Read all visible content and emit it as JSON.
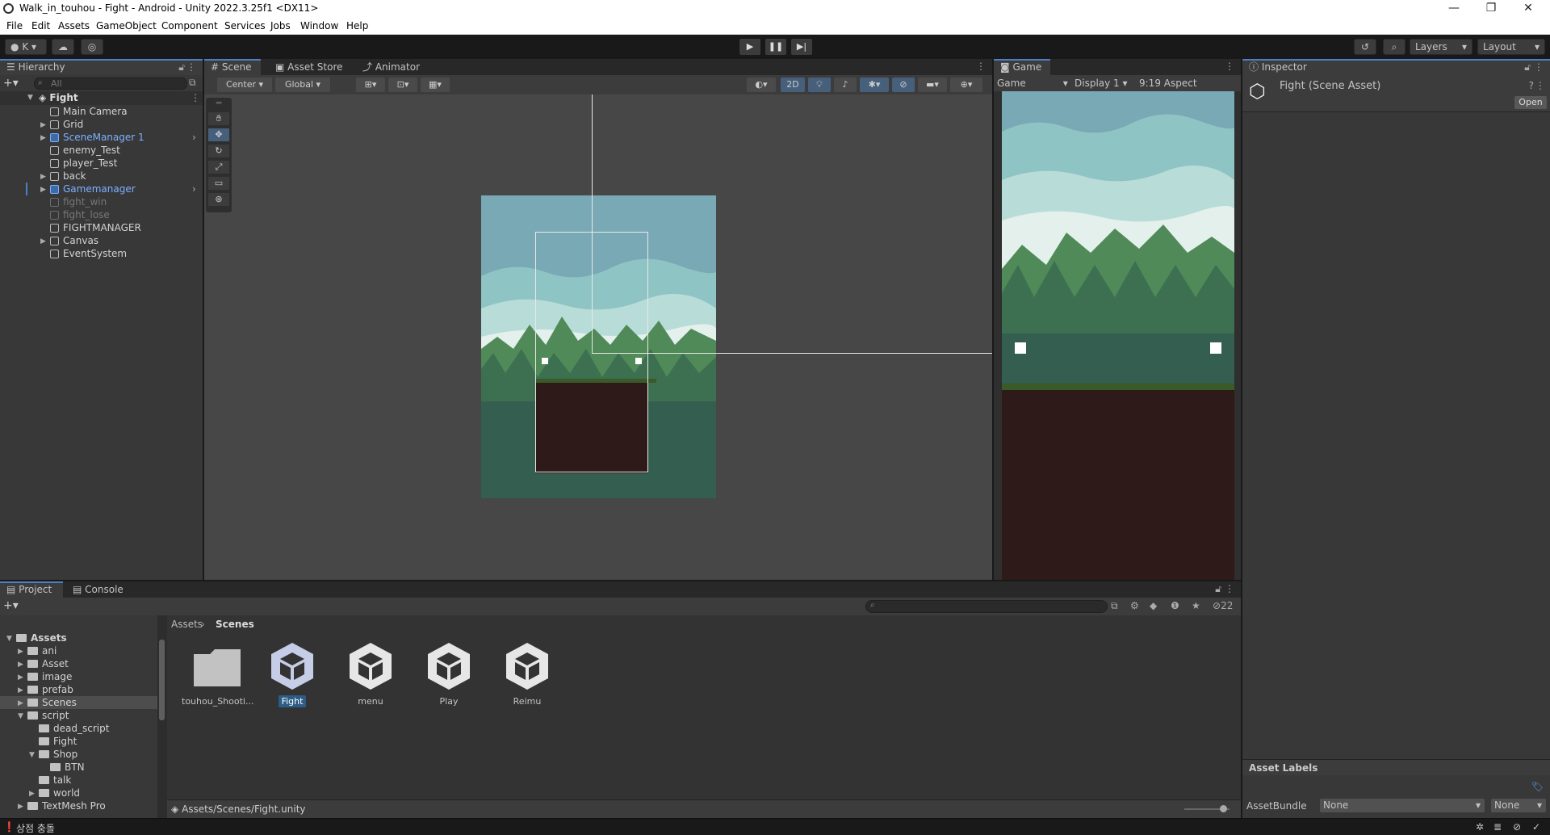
{
  "window": {
    "title": "Walk_in_touhou - Fight - Android - Unity 2022.3.25f1 <DX11>",
    "minimize": "—",
    "maximize": "❐",
    "close": "✕"
  },
  "menu": [
    "File",
    "Edit",
    "Assets",
    "GameObject",
    "Component",
    "Services",
    "Jobs",
    "Window",
    "Help"
  ],
  "toolbar": {
    "account": "K",
    "layers": "Layers",
    "layout": "Layout"
  },
  "hierarchy": {
    "tab": "Hierarchy",
    "search_placeholder": "All",
    "scene": "Fight",
    "items": [
      {
        "label": "Main Camera",
        "expandable": false,
        "style": "normal"
      },
      {
        "label": "Grid",
        "expandable": true,
        "style": "normal"
      },
      {
        "label": "SceneManager 1",
        "expandable": true,
        "style": "prefab"
      },
      {
        "label": "enemy_Test",
        "expandable": false,
        "style": "normal"
      },
      {
        "label": "player_Test",
        "expandable": false,
        "style": "normal"
      },
      {
        "label": "back",
        "expandable": true,
        "style": "normal"
      },
      {
        "label": "Gamemanager",
        "expandable": true,
        "style": "prefab"
      },
      {
        "label": "fight_win",
        "expandable": false,
        "style": "disabled"
      },
      {
        "label": "fight_lose",
        "expandable": false,
        "style": "disabled"
      },
      {
        "label": "FIGHTMANAGER",
        "expandable": false,
        "style": "normal"
      },
      {
        "label": "Canvas",
        "expandable": true,
        "style": "normal"
      },
      {
        "label": "EventSystem",
        "expandable": false,
        "style": "normal"
      }
    ]
  },
  "scene": {
    "tabs": [
      "Scene",
      "Asset Store",
      "Animator"
    ],
    "pivot": "Center",
    "space": "Global",
    "mode2d": "2D"
  },
  "game": {
    "tab": "Game",
    "view": "Game",
    "display": "Display 1",
    "aspect": "9:19 Aspect"
  },
  "inspector": {
    "tab": "Inspector",
    "title": "Fight (Scene Asset)",
    "open": "Open",
    "asset_labels": "Asset Labels",
    "assetbundle_label": "AssetBundle",
    "assetbundle_value": "None",
    "assetbundle_variant": "None"
  },
  "project": {
    "tabs": [
      "Project",
      "Console"
    ],
    "hidden_count": "22",
    "breadcrumb": [
      "Assets",
      "Scenes"
    ],
    "tree": [
      {
        "label": "Assets",
        "indent": 0,
        "open": true,
        "bold": true
      },
      {
        "label": "ani",
        "indent": 1,
        "open": false
      },
      {
        "label": "Asset",
        "indent": 1,
        "open": false
      },
      {
        "label": "image",
        "indent": 1,
        "open": false
      },
      {
        "label": "prefab",
        "indent": 1,
        "open": false
      },
      {
        "label": "Scenes",
        "indent": 1,
        "open": false,
        "selected": true
      },
      {
        "label": "script",
        "indent": 1,
        "open": true
      },
      {
        "label": "dead_script",
        "indent": 2,
        "open": null
      },
      {
        "label": "Fight",
        "indent": 2,
        "open": null
      },
      {
        "label": "Shop",
        "indent": 2,
        "open": true
      },
      {
        "label": "BTN",
        "indent": 3,
        "open": null
      },
      {
        "label": "talk",
        "indent": 2,
        "open": null
      },
      {
        "label": "world",
        "indent": 2,
        "open": false
      },
      {
        "label": "TextMesh Pro",
        "indent": 1,
        "open": false
      }
    ],
    "assets": [
      {
        "label": "touhou_Shooti...",
        "kind": "folder"
      },
      {
        "label": "Fight",
        "kind": "scene",
        "selected": true
      },
      {
        "label": "menu",
        "kind": "scene"
      },
      {
        "label": "Play",
        "kind": "scene"
      },
      {
        "label": "Reimu",
        "kind": "scene"
      }
    ],
    "path": "Assets/Scenes/Fight.unity"
  },
  "statusbar": {
    "message": "상점 충돌"
  },
  "colors": {
    "accent": "#4c7fc4",
    "prefab": "#7cb0ff",
    "panel": "#383838",
    "sky": "#7aa9b6",
    "ground": "#2e1a18"
  }
}
